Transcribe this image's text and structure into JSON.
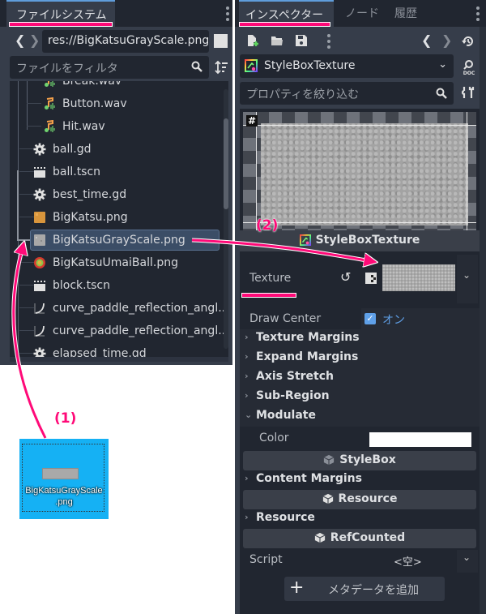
{
  "filesystem": {
    "tab_label": "ファイルシステム",
    "path": "res://BigKatsuGrayScale.png",
    "filter_placeholder": "ファイルをフィルタ",
    "files": [
      {
        "name": "Break.wav",
        "icon": "audio-icon",
        "indent": 2,
        "partial": true
      },
      {
        "name": "Button.wav",
        "icon": "audio-icon",
        "indent": 2
      },
      {
        "name": "Hit.wav",
        "icon": "audio-icon",
        "indent": 2
      },
      {
        "name": "ball.gd",
        "icon": "gear-script-icon",
        "indent": 1
      },
      {
        "name": "ball.tscn",
        "icon": "scene-clapper-icon",
        "indent": 1
      },
      {
        "name": "best_time.gd",
        "icon": "gear-script-icon",
        "indent": 1
      },
      {
        "name": "BigKatsu.png",
        "icon": "image-orange-icon",
        "indent": 1
      },
      {
        "name": "BigKatsuGrayScale.png",
        "icon": "image-gray-icon",
        "indent": 1,
        "selected": true
      },
      {
        "name": "BigKatsuUmaiBall.png",
        "icon": "image-ball-icon",
        "indent": 1
      },
      {
        "name": "block.tscn",
        "icon": "scene-clapper-icon",
        "indent": 1
      },
      {
        "name": "curve_paddle_reflection_angl...",
        "icon": "curve-icon",
        "indent": 1
      },
      {
        "name": "curve_paddle_reflection_angl...",
        "icon": "curve-icon",
        "indent": 1
      },
      {
        "name": "elapsed_time.gd",
        "icon": "gear-script-icon",
        "indent": 1,
        "partial": true
      }
    ]
  },
  "inspector": {
    "tabs": [
      {
        "label": "インスペクター",
        "active": true
      },
      {
        "label": "ノード",
        "active": false
      },
      {
        "label": "履歴",
        "active": false
      }
    ],
    "resource_type": "StyleBoxTexture",
    "filter_placeholder": "プロパティを絞り込む",
    "preview_label": "StyleBoxTexture",
    "texture_label": "Texture",
    "draw_center": {
      "label": "Draw Center",
      "value": "オン",
      "checked": true
    },
    "sections": [
      {
        "label": "Texture Margins",
        "expanded": false
      },
      {
        "label": "Expand Margins",
        "expanded": false
      },
      {
        "label": "Axis Stretch",
        "expanded": false
      },
      {
        "label": "Sub-Region",
        "expanded": false
      },
      {
        "label": "Modulate",
        "expanded": true
      }
    ],
    "modulate_color": {
      "label": "Color",
      "value": "#ffffff"
    },
    "class_stylebox": "StyleBox",
    "content_margins": "Content Margins",
    "class_resource": "Resource",
    "resource_section": "Resource",
    "class_refcounted": "RefCounted",
    "script": {
      "label": "Script",
      "value": "<空>"
    },
    "add_metadata": "メタデータを追加"
  },
  "annotations": {
    "step1": "(1)",
    "step2": "(2)",
    "accent": "#ff0a78"
  },
  "desktop_file": {
    "name_line1": "BigKatsuGrayScale",
    "name_line2": ".png"
  }
}
